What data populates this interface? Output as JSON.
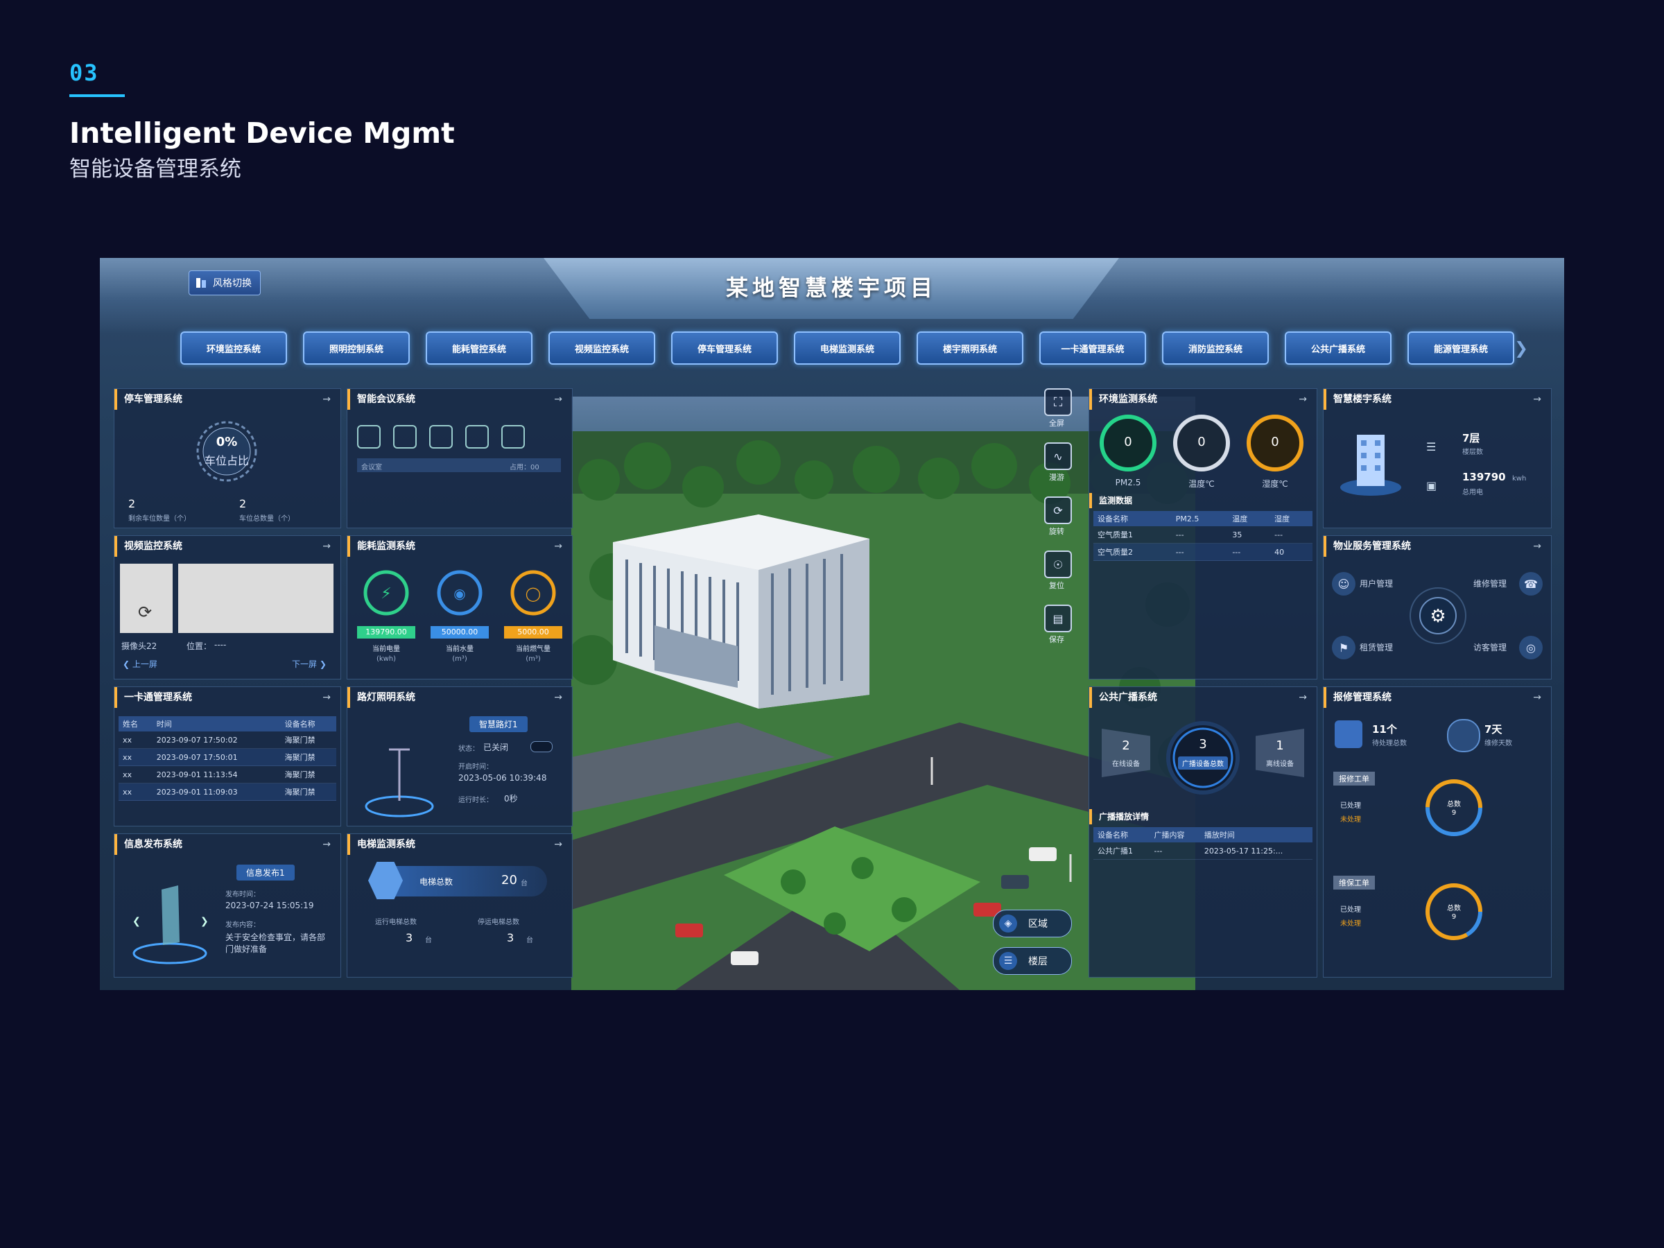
{
  "page": {
    "section_number": "03",
    "title_en": "Intelligent Device Mgmt",
    "title_cn": "智能设备管理系统"
  },
  "dashboard": {
    "title": "某地智慧楼宇项目",
    "style_switch": "风格切换",
    "nav": [
      "环境监控系统",
      "照明控制系统",
      "能耗管控系统",
      "视频监控系统",
      "停车管理系统",
      "电梯监测系统",
      "楼宇照明系统",
      "一卡通管理系统",
      "消防监控系统",
      "公共广播系统",
      "能源管理系统"
    ],
    "left": {
      "parking": {
        "title": "停车管理系统",
        "gauge_value": "0%",
        "gauge_label": "车位占比",
        "free_count": "2",
        "free_label": "剩余车位数量（个）",
        "total_count": "2",
        "total_label": "车位总数量（个）"
      },
      "video": {
        "title": "视频监控系统",
        "camera_label": "摄像头22",
        "position_label": "位置：",
        "position_value": "----",
        "prev": "上一屏",
        "next": "下一屏"
      },
      "access": {
        "title": "一卡通管理系统",
        "headers": [
          "姓名",
          "时间",
          "设备名称"
        ],
        "rows": [
          [
            "xx",
            "2023-09-07 17:50:02",
            "海聚门禁"
          ],
          [
            "xx",
            "2023-09-07 17:50:01",
            "海聚门禁"
          ],
          [
            "xx",
            "2023-09-01 11:13:54",
            "海聚门禁"
          ],
          [
            "xx",
            "2023-09-01 11:09:03",
            "海聚门禁"
          ]
        ]
      },
      "info": {
        "title": "信息发布系统",
        "tag": "信息发布1",
        "time_label": "发布时间：",
        "time_value": "2023-07-24 15:05:19",
        "content_label": "发布内容：",
        "content_value": "关于安全检查事宜，请各部门做好准备"
      }
    },
    "mid_left": {
      "conference": {
        "title": "智能会议系统",
        "room_label": "会议室",
        "status": "占用：00"
      },
      "energy": {
        "title": "能耗监测系统",
        "items": [
          {
            "value": "139790.00",
            "label": "当前电量",
            "unit": "(kwh)",
            "color": "#2fd08b"
          },
          {
            "value": "50000.00",
            "label": "当前水量",
            "unit": "(m³)",
            "color": "#3a8fe6"
          },
          {
            "value": "5000.00",
            "label": "当前燃气量",
            "unit": "(m³)",
            "color": "#f0a21c"
          }
        ]
      },
      "lighting": {
        "title": "路灯照明系统",
        "tag": "智慧路灯1",
        "state_label": "状态：",
        "state_value": "已关闭",
        "open_label": "开启时间：",
        "open_value": "2023-05-06 10:39:48",
        "run_label": "运行时长：",
        "run_value": "0秒"
      },
      "elevator": {
        "title": "电梯监测系统",
        "label": "电梯总数",
        "count": "20",
        "unit": "台",
        "run_label": "运行电梯总数",
        "run_value": "3",
        "stop_label": "停运电梯总数",
        "stop_value": "3",
        "small_unit": "台"
      }
    },
    "toolbar": [
      {
        "icon": "fullscreen-icon",
        "label": "全屏"
      },
      {
        "icon": "roam-icon",
        "label": "漫游"
      },
      {
        "icon": "rotate-icon",
        "label": "旋转"
      },
      {
        "icon": "reset-view-icon",
        "label": "复位"
      },
      {
        "icon": "save-icon",
        "label": "保存"
      }
    ],
    "scene_buttons": [
      "区域",
      "楼层"
    ],
    "right": {
      "environment": {
        "title": "环境监测系统",
        "gauges": [
          {
            "value": "0",
            "label": "PM2.5",
            "color": "#25d38a"
          },
          {
            "value": "0",
            "label": "温度℃",
            "color": "#d6dde8"
          },
          {
            "value": "0",
            "label": "湿度℃",
            "color": "#f0a21c"
          }
        ],
        "sub_title": "监测数据",
        "headers": [
          "设备名称",
          "PM2.5",
          "温度",
          "湿度"
        ],
        "rows": [
          [
            "空气质量1",
            "---",
            "35",
            "---"
          ],
          [
            "空气质量2",
            "---",
            "---",
            "40"
          ]
        ]
      },
      "building": {
        "title": "智慧楼宇系统",
        "floors_value": "7层",
        "floors_label": "楼层数",
        "area_value": "139790",
        "area_unit": "kwh",
        "area_label": "总用电"
      },
      "property": {
        "title": "物业服务管理系统",
        "items": [
          "用户管理",
          "维修管理",
          "租赁管理",
          "访客管理"
        ]
      },
      "broadcast": {
        "title": "公共广播系统",
        "left_value": "2",
        "left_label": "在线设备",
        "center_value": "3",
        "center_label": "广播设备总数",
        "right_value": "1",
        "right_label": "离线设备",
        "sub_title": "广播播放详情",
        "headers": [
          "设备名称",
          "广播内容",
          "播放时间"
        ],
        "rows": [
          [
            "公共广播1",
            "---",
            "2023-05-17 11:25:..."
          ]
        ]
      },
      "workorder": {
        "title": "报修管理系统",
        "orders_value": "11个",
        "orders_label": "待处理总数",
        "days_value": "7天",
        "days_label": "维修天数",
        "repair_title": "报修工单",
        "repair_items": [
          "已处理",
          "未处理"
        ],
        "repair_ring_label": "总数",
        "repair_ring_value": "9",
        "maint_title": "维保工单",
        "maint_items": [
          "已处理",
          "未处理"
        ],
        "maint_ring_label": "总数",
        "maint_ring_value": "9"
      }
    }
  }
}
